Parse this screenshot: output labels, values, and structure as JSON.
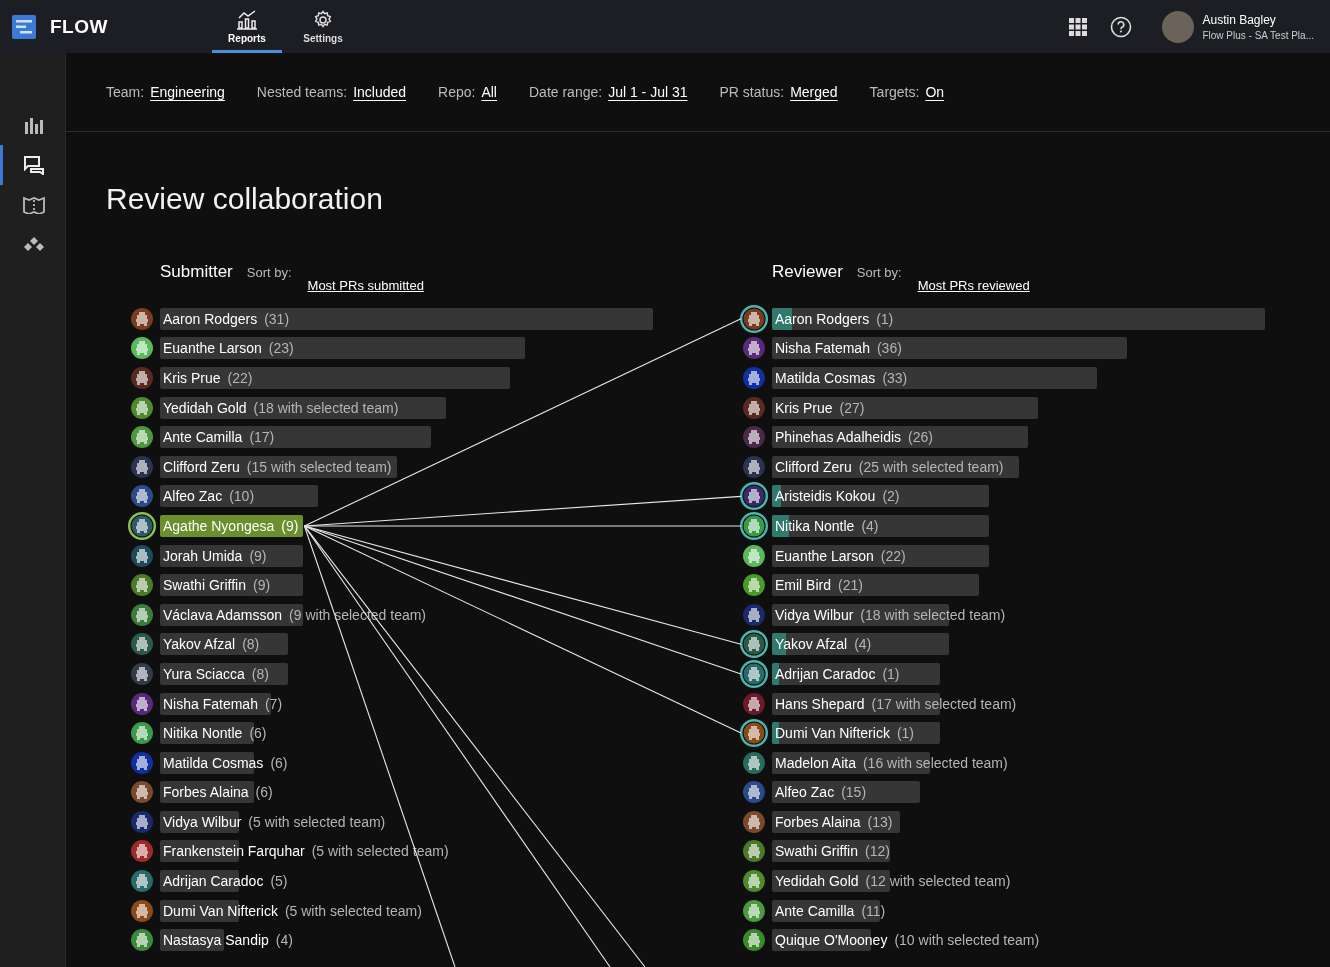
{
  "app": {
    "name": "FLOW"
  },
  "nav_tabs": [
    {
      "label": "Reports",
      "kind": "reports",
      "selected": true
    },
    {
      "label": "Settings",
      "kind": "settings",
      "selected": false
    }
  ],
  "user": {
    "name": "Austin Bagley",
    "plan": "Flow Plus - SA Test Pla..."
  },
  "sidebar": {
    "items": [
      {
        "kind": "chart",
        "selected": false
      },
      {
        "kind": "review",
        "selected": true
      },
      {
        "kind": "map",
        "selected": false
      },
      {
        "kind": "modules",
        "selected": false
      }
    ]
  },
  "filters": [
    {
      "label": "Team:",
      "value": "Engineering"
    },
    {
      "label": "Nested teams:",
      "value": "Included"
    },
    {
      "label": "Repo:",
      "value": "All"
    },
    {
      "label": "Date range:",
      "value": "Jul 1 - Jul 31"
    },
    {
      "label": "PR status:",
      "value": "Merged"
    },
    {
      "label": "Targets:",
      "value": "On"
    }
  ],
  "title": "Review collaboration",
  "submitter": {
    "heading": "Submitter",
    "sort_label": "Sort by:",
    "sort_value": "Most PRs submitted",
    "rows": [
      {
        "name": "Aaron Rodgers",
        "count": "(31)",
        "level": 1.0,
        "color": "#7a3b1e",
        "selected": false
      },
      {
        "name": "Euanthe Larson",
        "count": "(23)",
        "level": 0.74,
        "color": "#5cb85c",
        "selected": false
      },
      {
        "name": "Kris Prue",
        "count": "(22)",
        "level": 0.71,
        "color": "#5a2a22",
        "selected": false
      },
      {
        "name": "Yedidah Gold",
        "count": "(18 with selected team)",
        "level": 0.58,
        "color": "#4e8a2e",
        "selected": false
      },
      {
        "name": "Ante Camilla",
        "count": "(17)",
        "level": 0.55,
        "color": "#4d9a3e",
        "selected": false
      },
      {
        "name": "Clifford Zeru",
        "count": "(15 with selected team)",
        "level": 0.48,
        "color": "#2a3350",
        "selected": false
      },
      {
        "name": "Alfeo Zac",
        "count": "(10)",
        "level": 0.32,
        "color": "#2c4a8a",
        "selected": false
      },
      {
        "name": "Agathe Nyongesa",
        "count": "(9)",
        "level": 0.29,
        "color": "#2d5a6a",
        "selected": true
      },
      {
        "name": "Jorah Umida",
        "count": "(9)",
        "level": 0.29,
        "color": "#1f4a5c",
        "selected": false
      },
      {
        "name": "Swathi Griffin",
        "count": "(9)",
        "level": 0.29,
        "color": "#4a7a2a",
        "selected": false
      },
      {
        "name": "Václava Adamsson",
        "count": "(9 with selected team)",
        "level": 0.29,
        "color": "#3d7a3d",
        "selected": false
      },
      {
        "name": "Yakov Afzal",
        "count": "(8)",
        "level": 0.26,
        "color": "#2a5a4a",
        "selected": false
      },
      {
        "name": "Yura Sciacca",
        "count": "(8)",
        "level": 0.26,
        "color": "#333a48",
        "selected": false
      },
      {
        "name": "Nisha Fatemah",
        "count": "(7)",
        "level": 0.225,
        "color": "#5a2a7a",
        "selected": false
      },
      {
        "name": "Nitika Nontle",
        "count": "(6)",
        "level": 0.19,
        "color": "#3a9a4a",
        "selected": false
      },
      {
        "name": "Matilda Cosmas",
        "count": "(6)",
        "level": 0.19,
        "color": "#1030a0",
        "selected": false
      },
      {
        "name": "Forbes Alaina",
        "count": "(6)",
        "level": 0.19,
        "color": "#7a4a2a",
        "selected": false
      },
      {
        "name": "Vidya Wilbur",
        "count": "(5 with selected team)",
        "level": 0.16,
        "color": "#1a2a6a",
        "selected": false
      },
      {
        "name": "Frankenstein Farquhar",
        "count": "(5 with selected team)",
        "level": 0.16,
        "color": "#a02a2a",
        "selected": false
      },
      {
        "name": "Adrijan Caradoc",
        "count": "(5)",
        "level": 0.16,
        "color": "#2a6a6a",
        "selected": false
      },
      {
        "name": "Dumi Van Nifterick",
        "count": "(5 with selected team)",
        "level": 0.16,
        "color": "#8a4a1a",
        "selected": false
      },
      {
        "name": "Nastasya Sandip",
        "count": "(4)",
        "level": 0.13,
        "color": "#3a8a3a",
        "selected": false
      }
    ]
  },
  "reviewer": {
    "heading": "Reviewer",
    "sort_label": "Sort by:",
    "sort_value": "Most PRs reviewed",
    "rows": [
      {
        "name": "Aaron Rodgers",
        "count": "(1)",
        "level": 1.0,
        "overlap": {
          "level": 0.04
        },
        "connected": true,
        "color": "#7a3b1e"
      },
      {
        "name": "Nisha Fatemah",
        "count": "(36)",
        "level": 0.72,
        "connected": false,
        "color": "#5a2a7a"
      },
      {
        "name": "Matilda Cosmas",
        "count": "(33)",
        "level": 0.66,
        "connected": false,
        "color": "#1030a0"
      },
      {
        "name": "Kris Prue",
        "count": "(27)",
        "level": 0.54,
        "connected": false,
        "color": "#5a2a22"
      },
      {
        "name": "Phinehas Adalheidis",
        "count": "(26)",
        "level": 0.52,
        "connected": false,
        "color": "#4a2a4a"
      },
      {
        "name": "Clifford Zeru",
        "count": "(25 with selected team)",
        "level": 0.5,
        "connected": false,
        "color": "#2a3350"
      },
      {
        "name": "Aristeidis Kokou",
        "count": "(2)",
        "level": 0.44,
        "overlap": {
          "level": 0.04
        },
        "connected": true,
        "color": "#3a2a6a"
      },
      {
        "name": "Nitika Nontle",
        "count": "(4)",
        "level": 0.44,
        "overlap": {
          "level": 0.08
        },
        "connected": true,
        "color": "#3a9a4a"
      },
      {
        "name": "Euanthe Larson",
        "count": "(22)",
        "level": 0.44,
        "connected": false,
        "color": "#5cb85c"
      },
      {
        "name": "Emil Bird",
        "count": "(21)",
        "level": 0.42,
        "connected": false,
        "color": "#4a9a2a"
      },
      {
        "name": "Vidya Wilbur",
        "count": "(18 with selected team)",
        "level": 0.36,
        "connected": false,
        "color": "#1a2a6a"
      },
      {
        "name": "Yakov Afzal",
        "count": "(4)",
        "level": 0.36,
        "overlap": {
          "level": 0.08
        },
        "connected": true,
        "color": "#2a5a4a"
      },
      {
        "name": "Adrijan Caradoc",
        "count": "(1)",
        "level": 0.34,
        "overlap": {
          "level": 0.04
        },
        "connected": true,
        "color": "#2a6a6a"
      },
      {
        "name": "Hans Shepard",
        "count": "(17 with selected team)",
        "level": 0.34,
        "connected": false,
        "color": "#6a1a2a"
      },
      {
        "name": "Dumi Van Nifterick",
        "count": "(1)",
        "level": 0.34,
        "overlap": {
          "level": 0.04
        },
        "connected": true,
        "color": "#8a4a1a"
      },
      {
        "name": "Madelon Aita",
        "count": "(16 with selected team)",
        "level": 0.32,
        "connected": false,
        "color": "#2a6a5a"
      },
      {
        "name": "Alfeo Zac",
        "count": "(15)",
        "level": 0.3,
        "connected": false,
        "color": "#2c4a8a"
      },
      {
        "name": "Forbes Alaina",
        "count": "(13)",
        "level": 0.26,
        "connected": false,
        "color": "#7a4a2a"
      },
      {
        "name": "Swathi Griffin",
        "count": "(12)",
        "level": 0.24,
        "connected": false,
        "color": "#4a7a2a"
      },
      {
        "name": "Yedidah Gold",
        "count": "(12 with selected team)",
        "level": 0.24,
        "connected": false,
        "color": "#4e8a2e"
      },
      {
        "name": "Ante Camilla",
        "count": "(11)",
        "level": 0.22,
        "connected": false,
        "color": "#4d9a3e"
      },
      {
        "name": "Quique O'Mooney",
        "count": "(10 with selected team)",
        "level": 0.2,
        "connected": false,
        "color": "#3a8a2a"
      }
    ]
  }
}
